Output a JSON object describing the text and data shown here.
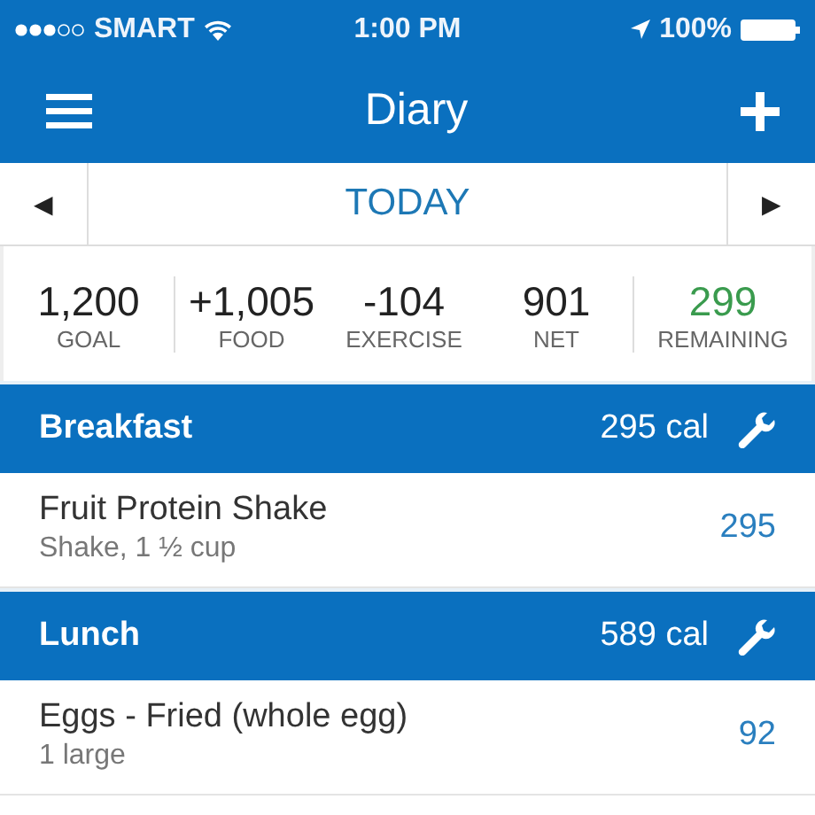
{
  "status_bar": {
    "carrier": "SMART",
    "time": "1:00 PM",
    "battery": "100%"
  },
  "nav_bar": {
    "title": "Diary"
  },
  "date_bar": {
    "prev": "◀",
    "label": "TODAY",
    "next": "▶"
  },
  "summary": [
    {
      "value": "1,200",
      "label": "GOAL",
      "kind": "plain"
    },
    {
      "value": "+1,005",
      "label": "FOOD",
      "kind": "plain"
    },
    {
      "value": "-104",
      "label": "EXERCISE",
      "kind": "plain"
    },
    {
      "value": "901",
      "label": "NET",
      "kind": "plain"
    },
    {
      "value": "299",
      "label": "REMAINING",
      "kind": "remaining"
    }
  ],
  "meals": [
    {
      "name": "Breakfast",
      "calories": "295 cal",
      "entries": [
        {
          "name": "Fruit Protein Shake",
          "serving": "Shake, 1 ½ cup",
          "calories": "295"
        }
      ]
    },
    {
      "name": "Lunch",
      "calories": "589 cal",
      "entries": [
        {
          "name": "Eggs - Fried (whole egg)",
          "serving": "1 large",
          "calories": "92"
        }
      ]
    }
  ]
}
